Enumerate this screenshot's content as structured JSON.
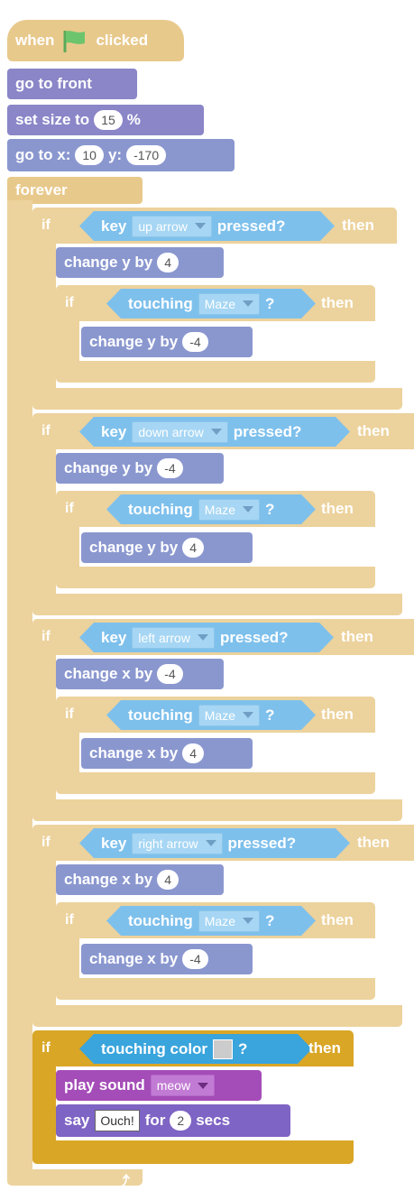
{
  "hat": {
    "when": "when",
    "clicked": "clicked",
    "flag_icon": "green-flag-icon"
  },
  "blocks": {
    "go_front": "go to front",
    "set_size_a": "set size to",
    "set_size_val": "15",
    "set_size_b": "%",
    "goto_a": "go to x:",
    "goto_x": "10",
    "goto_b": "y:",
    "goto_y": "-170",
    "forever": "forever"
  },
  "common": {
    "if": "if",
    "then": "then",
    "key": "key",
    "pressed": "pressed?",
    "touching": "touching",
    "q": "?",
    "maze": "Maze"
  },
  "ifs": [
    {
      "arrow": "up arrow",
      "outer_change": "change y by",
      "outer_val": "4",
      "inner_change": "change y by",
      "inner_val": "-4"
    },
    {
      "arrow": "down arrow",
      "outer_change": "change y by",
      "outer_val": "-4",
      "inner_change": "change y by",
      "inner_val": "4"
    },
    {
      "arrow": "left arrow",
      "outer_change": "change x by",
      "outer_val": "-4",
      "inner_change": "change x by",
      "inner_val": "4"
    },
    {
      "arrow": "right arrow",
      "outer_change": "change x by",
      "outer_val": "4",
      "inner_change": "change x by",
      "inner_val": "-4"
    }
  ],
  "final_if": {
    "touching_color": "touching color",
    "play_sound": "play sound",
    "sound": "meow",
    "say": "say",
    "say_text": "Ouch!",
    "for": "for",
    "secs_val": "2",
    "secs": "secs"
  },
  "colors": {
    "control": "#e8c98c",
    "looks": "#8a86c8",
    "sensing": "#7ec0ec",
    "sound": "#a44cb7",
    "events": "#d9a626"
  }
}
